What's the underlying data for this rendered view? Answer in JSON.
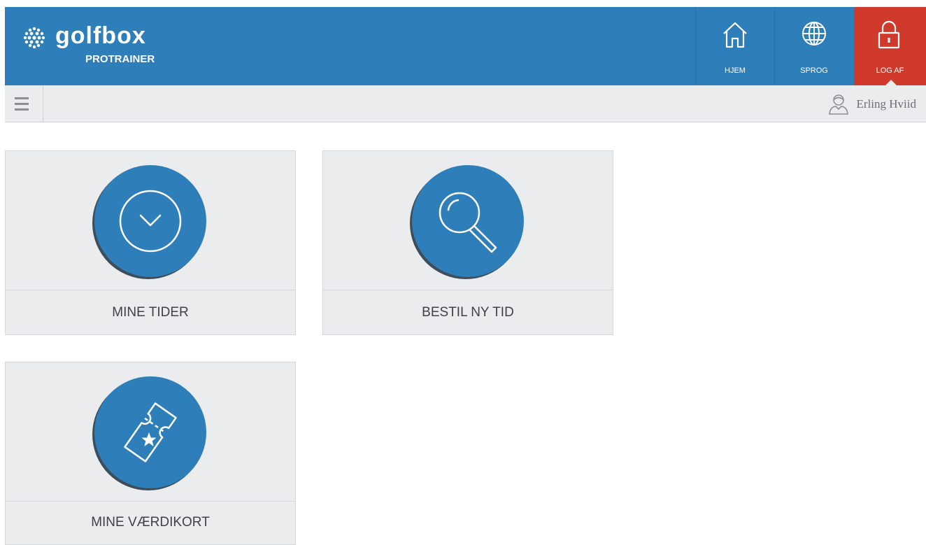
{
  "header": {
    "brand": "golfbox",
    "product": "PROTRAINER",
    "accent": "#2d7eb9",
    "logout_color": "#d03a2c"
  },
  "nav": {
    "home": {
      "label": "HJEM",
      "icon": "home-icon"
    },
    "language": {
      "label": "SPROG",
      "icon": "globe-icon"
    },
    "logout": {
      "label": "LOG AF",
      "icon": "padlock-icon"
    }
  },
  "subbar": {
    "menu_icon": "hamburger-icon",
    "user_name": "Erling Hviid"
  },
  "tiles": [
    {
      "label": "MINE TIDER",
      "icon": "clock-icon"
    },
    {
      "label": "BESTIL NY TID",
      "icon": "magnifier-icon"
    },
    {
      "label": "MINE VÆRDIKORT",
      "icon": "ticket-icon"
    }
  ]
}
